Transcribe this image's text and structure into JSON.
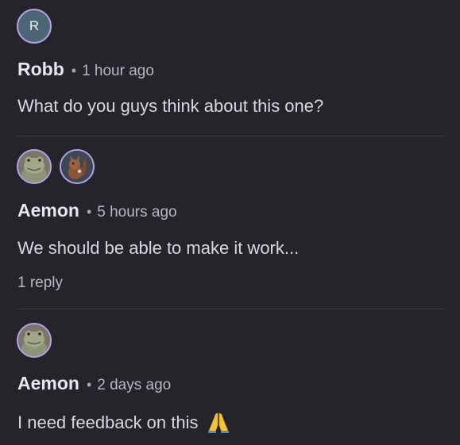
{
  "comments": [
    {
      "avatars": [
        {
          "type": "letter",
          "initial": "R",
          "color": "#4d6676"
        }
      ],
      "author": "Robb",
      "separator": "•",
      "time": "1 hour ago",
      "text": "What do you guys think about this one?"
    },
    {
      "avatars": [
        {
          "type": "image",
          "icon": "frog-avatar-icon"
        },
        {
          "type": "image",
          "icon": "squirrel-avatar-icon"
        }
      ],
      "author": "Aemon",
      "separator": "•",
      "time": "5 hours ago",
      "text": "We should be able to make it work...",
      "reply_label": "1 reply"
    },
    {
      "avatars": [
        {
          "type": "image",
          "icon": "frog-avatar-icon"
        }
      ],
      "author": "Aemon",
      "separator": "•",
      "time": "2 days ago",
      "text": "I need feedback on this",
      "emoji": "folded-hands-icon"
    }
  ],
  "colors": {
    "background": "#25242a",
    "avatar_ring": "#b6a3ec",
    "divider": "#3c3b42"
  }
}
